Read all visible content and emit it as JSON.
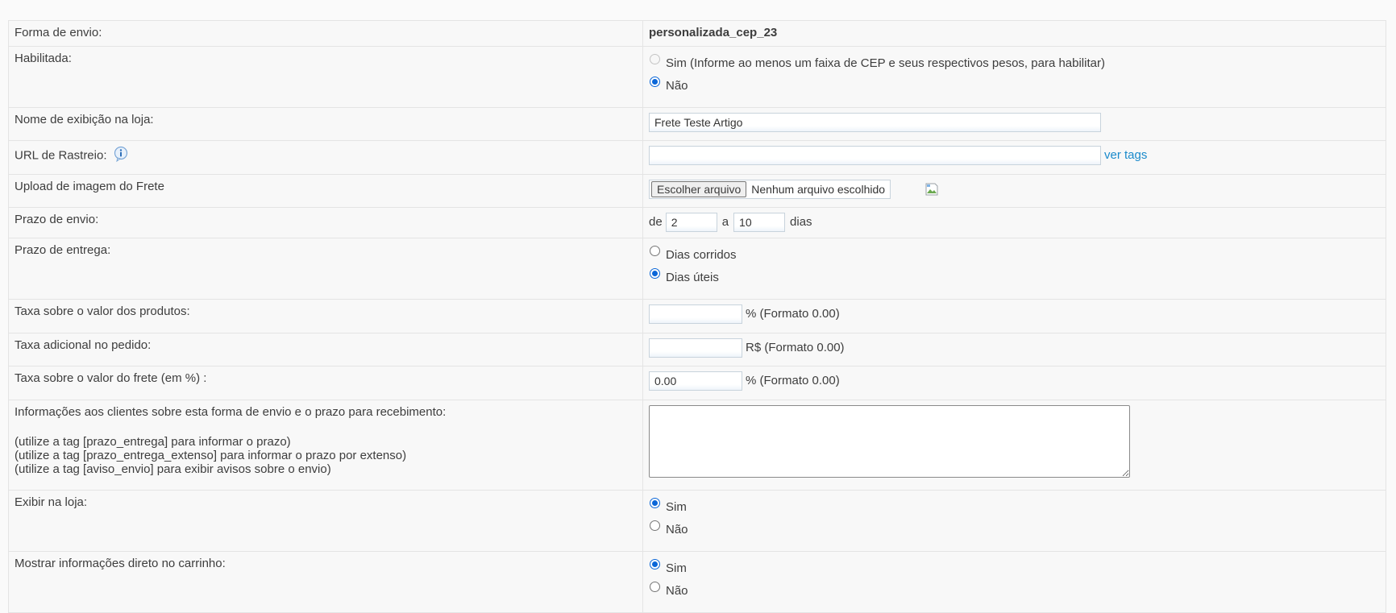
{
  "form": {
    "forma_envio": {
      "label": "Forma de envio:",
      "value": "personalizada_cep_23"
    },
    "habilitada": {
      "label": "Habilitada:",
      "options": [
        {
          "label": "Sim (Informe ao menos um faixa de CEP e seus respectivos pesos, para habilitar)",
          "checked": false,
          "disabled": true
        },
        {
          "label": "Não",
          "checked": true,
          "disabled": false
        }
      ]
    },
    "nome_exibicao": {
      "label": "Nome de exibição na loja:",
      "value": "Frete Teste Artigo"
    },
    "url_rastreio": {
      "label": "URL de Rastreio:",
      "value": "",
      "link": "ver tags",
      "icon": "info-icon"
    },
    "upload_imagem": {
      "label": "Upload de imagem do Frete",
      "button": "Escolher arquivo",
      "file_status": "Nenhum arquivo escolhido",
      "icon": "broken-image-icon"
    },
    "prazo_envio": {
      "label": "Prazo de envio:",
      "de": "de",
      "de_value": "2",
      "a": "a",
      "a_value": "10",
      "unit": "dias"
    },
    "prazo_entrega": {
      "label": "Prazo de entrega:",
      "options": [
        {
          "label": "Dias corridos",
          "checked": false
        },
        {
          "label": "Dias úteis",
          "checked": true
        }
      ]
    },
    "taxa_produtos": {
      "label": "Taxa sobre o valor dos produtos:",
      "value": "",
      "suffix": "% (Formato 0.00)"
    },
    "taxa_adicional": {
      "label": "Taxa adicional no pedido:",
      "value": "",
      "suffix": "R$ (Formato 0.00)"
    },
    "taxa_frete": {
      "label": "Taxa sobre o valor do frete (em %) :",
      "value": "0.00",
      "suffix": "% (Formato 0.00)"
    },
    "informacoes": {
      "label": "Informações aos clientes sobre esta forma de envio e o prazo para recebimento:",
      "hints": [
        "(utilize a tag [prazo_entrega] para informar o prazo)",
        "(utilize a tag [prazo_entrega_extenso] para informar o prazo por extenso)",
        "(utilize a tag [aviso_envio] para exibir avisos sobre o envio)"
      ],
      "value": ""
    },
    "exibir_loja": {
      "label": "Exibir na loja:",
      "options": [
        {
          "label": "Sim",
          "checked": true
        },
        {
          "label": "Não",
          "checked": false
        }
      ]
    },
    "mostrar_carrinho": {
      "label": "Mostrar informações direto no carrinho:",
      "options": [
        {
          "label": "Sim",
          "checked": true
        },
        {
          "label": "Não",
          "checked": false
        }
      ]
    }
  },
  "colors": {
    "link": "#1a8acb",
    "radio_checked": "#0a66d8",
    "border": "#e4e4e4"
  }
}
